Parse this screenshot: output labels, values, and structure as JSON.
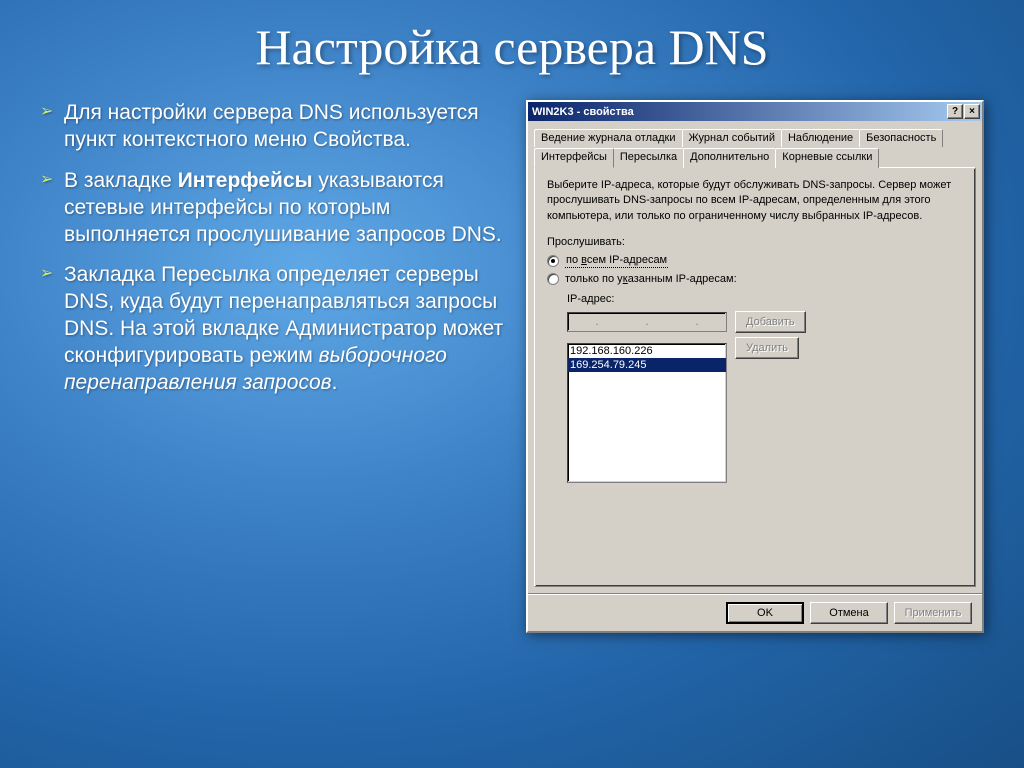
{
  "slide": {
    "title": "Настройка сервера DNS",
    "bullets": [
      {
        "plain": "Для настройки сервера DNS используется пункт контекстного меню Свойства."
      },
      {
        "prefix": "В закладке ",
        "bold": "Интерфейсы",
        "suffix": " указываются сетевые интерфейсы по которым выполняется прослушивание запросов DNS."
      },
      {
        "prefix": "Закладка Пересылка определяет серверы DNS, куда будут перенаправляться запросы DNS. На этой вкладке Администратор может сконфигурировать режим ",
        "italic": "выборочного перенаправления запросов",
        "suffix2": "."
      }
    ]
  },
  "dialog": {
    "title": "WIN2K3 - свойства",
    "help": "?",
    "close": "×",
    "tabs": {
      "row1": [
        "Ведение журнала отладки",
        "Журнал событий",
        "Наблюдение",
        "Безопасность"
      ],
      "row2": [
        "Интерфейсы",
        "Пересылка",
        "Дополнительно",
        "Корневые ссылки"
      ],
      "active": "Интерфейсы"
    },
    "description": "Выберите IP-адреса, которые будут обслуживать DNS-запросы. Сервер может прослушивать DNS-запросы по всем IP-адресам, определенным для этого компьютера, или только по ограниченному числу выбранных IP-адресов.",
    "listen_label": "Прослушивать:",
    "radio_all_pre": "по ",
    "radio_all_key": "в",
    "radio_all_post": "сем IP-адресам",
    "radio_selected_pre": "только по у",
    "radio_selected_key": "к",
    "radio_selected_post": "азанным IP-адресам:",
    "ip_label": "IP-адрес:",
    "ip_dots": ". . .",
    "add_btn": "Добавить",
    "remove_btn": "Удалить",
    "ip_list": [
      "192.168.160.226",
      "169.254.79.245"
    ],
    "selected_ip_index": 1,
    "ok": "OK",
    "cancel": "Отмена",
    "apply": "Применить"
  }
}
